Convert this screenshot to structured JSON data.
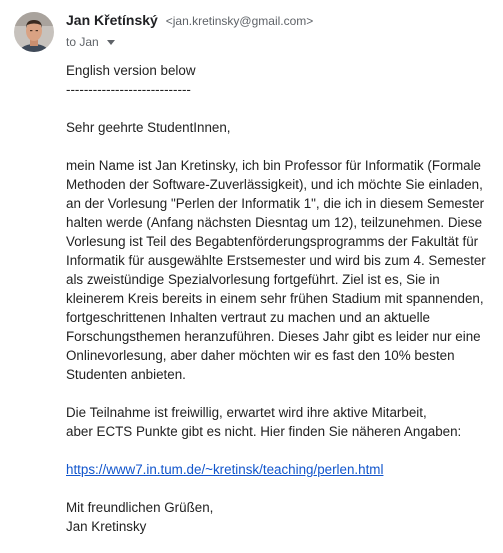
{
  "sender": {
    "name": "Jan Křetínský",
    "email": "<jan.kretinsky@gmail.com>"
  },
  "recipient": {
    "label": "to Jan"
  },
  "email_body": {
    "intro": [
      "English version below",
      "----------------------------"
    ],
    "salutation": "Sehr geehrte StudentInnen,",
    "paragraph1": [
      "mein Name ist Jan Kretinsky, ich bin Professor für Informatik (Formale",
      "Methoden der Software-Zuverlässigkeit), und ich möchte Sie einladen,",
      "an der Vorlesung \"Perlen der Informatik 1\", die ich in diesem Semester",
      "halten werde (Anfang nächsten Diesntag um 12), teilzunehmen. Diese",
      "Vorlesung ist Teil des Begabtenförderungsprogramms der Fakultät für",
      "Informatik für ausgewählte Erstsemester und wird bis zum 4. Semester",
      "als zweistündige Spezialvorlesung fortgeführt. Ziel ist es, Sie in",
      "kleinerem Kreis bereits in einem sehr frühen Stadium mit spannenden,",
      "fortgeschrittenen Inhalten vertraut zu machen und an aktuelle",
      "Forschungsthemen heranzuführen. Dieses Jahr gibt es leider nur eine",
      "Onlinevorlesung, aber daher möchten wir es fast den 10% besten",
      "Studenten anbieten."
    ],
    "paragraph2": [
      "Die Teilnahme ist freiwillig, erwartet wird ihre aktive Mitarbeit,",
      "aber ECTS Punkte gibt es nicht. Hier finden Sie näheren Angaben:"
    ],
    "link": "https://www7.in.tum.de/~kretinsk/teaching/perlen.html",
    "closing": [
      "Mit freundlichen Grüßen,",
      "Jan Kretinsky"
    ]
  },
  "colors": {
    "link": "#1155cc",
    "sender_name": "#202124",
    "meta_text": "#5f6368"
  }
}
